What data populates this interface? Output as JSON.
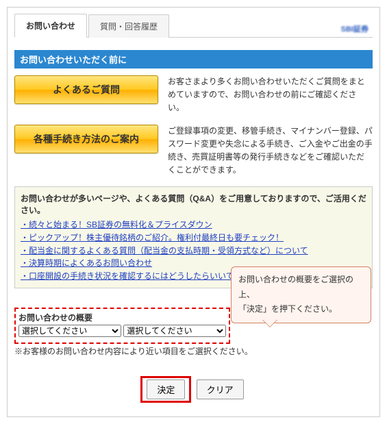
{
  "tabs": {
    "active": "お問い合わせ",
    "inactive": "質問・回答履歴"
  },
  "logo": "SBI証券",
  "section_header": "お問い合わせいただく前に",
  "row1": {
    "btn": "よくあるご質問",
    "text": "お客さまより多くお問い合わせいただくご質問をまとめていますので、お問い合わせの前にご確認ください。"
  },
  "row2": {
    "btn": "各種手続き方法のご案内",
    "text": "ご登録事項の変更、移管手続き、マイナンバー登録、パスワード変更や失念による手続き、ご入金やご出金の手続き、売買証明書等の発行手続きなどをご確認いただくことができます。"
  },
  "faq": {
    "heading": "お問い合わせが多いページや、よくある質問（Q&A）をご用意しておりますので、ご活用ください。",
    "links": [
      "・続々と始まる！SB証券の無料化＆プライスダウン",
      "・ピックアップ！株主優待銘柄のご紹介。権利付最終日も要チェック！",
      "・配当金に関するよくある質問（配当金の支払時期・受領方式など）について",
      "・決算時期によくあるお問い合わせ",
      "・口座開設の手続き状況を確認するにはどうしたらいいですか？"
    ]
  },
  "callout": {
    "line1": "お問い合わせの概要をご選択の上、",
    "line2": "「決定」を押下ください。"
  },
  "summary": {
    "title": "お問い合わせの概要",
    "select1_label": "選択してください",
    "select2_label": "選択してください"
  },
  "note": "※お客様のお問い合わせ内容により近い項目をご選択ください。",
  "buttons": {
    "submit": "決定",
    "clear": "クリア"
  }
}
